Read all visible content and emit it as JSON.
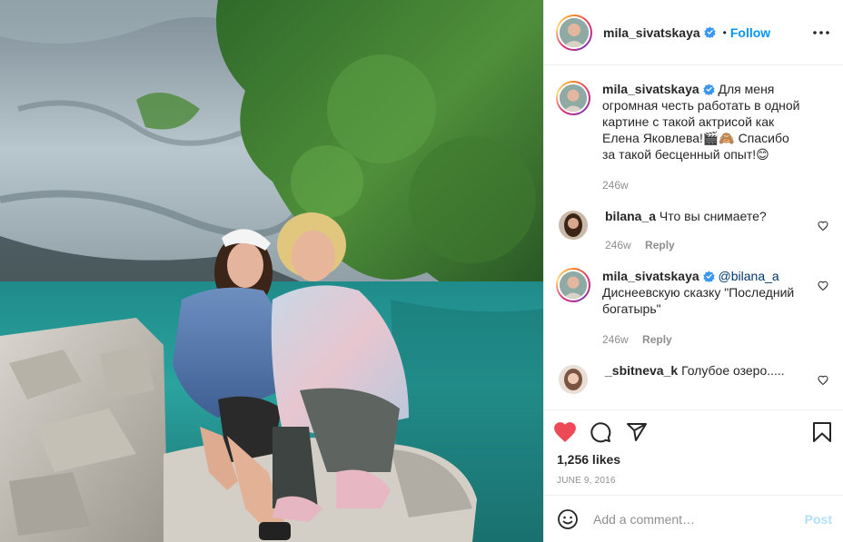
{
  "post": {
    "author": "mila_sivatskaya",
    "follow_label": "Follow",
    "separator": "•"
  },
  "icons": {
    "verified": "verified-badge-icon",
    "more": "more-options-icon",
    "like": "heart-filled-icon",
    "comment": "comment-bubble-icon",
    "share": "paper-plane-icon",
    "save": "bookmark-icon",
    "emoji": "smiley-icon"
  },
  "colors": {
    "accent": "#0095f6",
    "like_red": "#ed4956",
    "muted": "#8e8e8e",
    "post_disabled": "#b2dffc"
  },
  "caption": {
    "username": "mila_sivatskaya",
    "text": "Для меня огромная честь работать в одной картине с такой актрисой как Елена Яковлева!🎬🙈 Спасибо за такой бесценный опыт!😊",
    "time": "246w"
  },
  "comments": [
    {
      "username": "bilana_a",
      "text": "Что вы снимаете?",
      "time": "246w",
      "reply_label": "Reply"
    },
    {
      "username": "mila_sivatskaya",
      "mention": "@bilana_a",
      "text": "Диснеевскую сказку \"Последний богатырь\"",
      "time": "246w",
      "reply_label": "Reply"
    },
    {
      "username": "_sbitneva_k",
      "text": "Голубое озеро.....",
      "time": "",
      "reply_label": ""
    }
  ],
  "likes": "1,256 likes",
  "date": "JUNE 9, 2016",
  "add_comment": {
    "placeholder": "Add a comment…",
    "post_label": "Post"
  }
}
